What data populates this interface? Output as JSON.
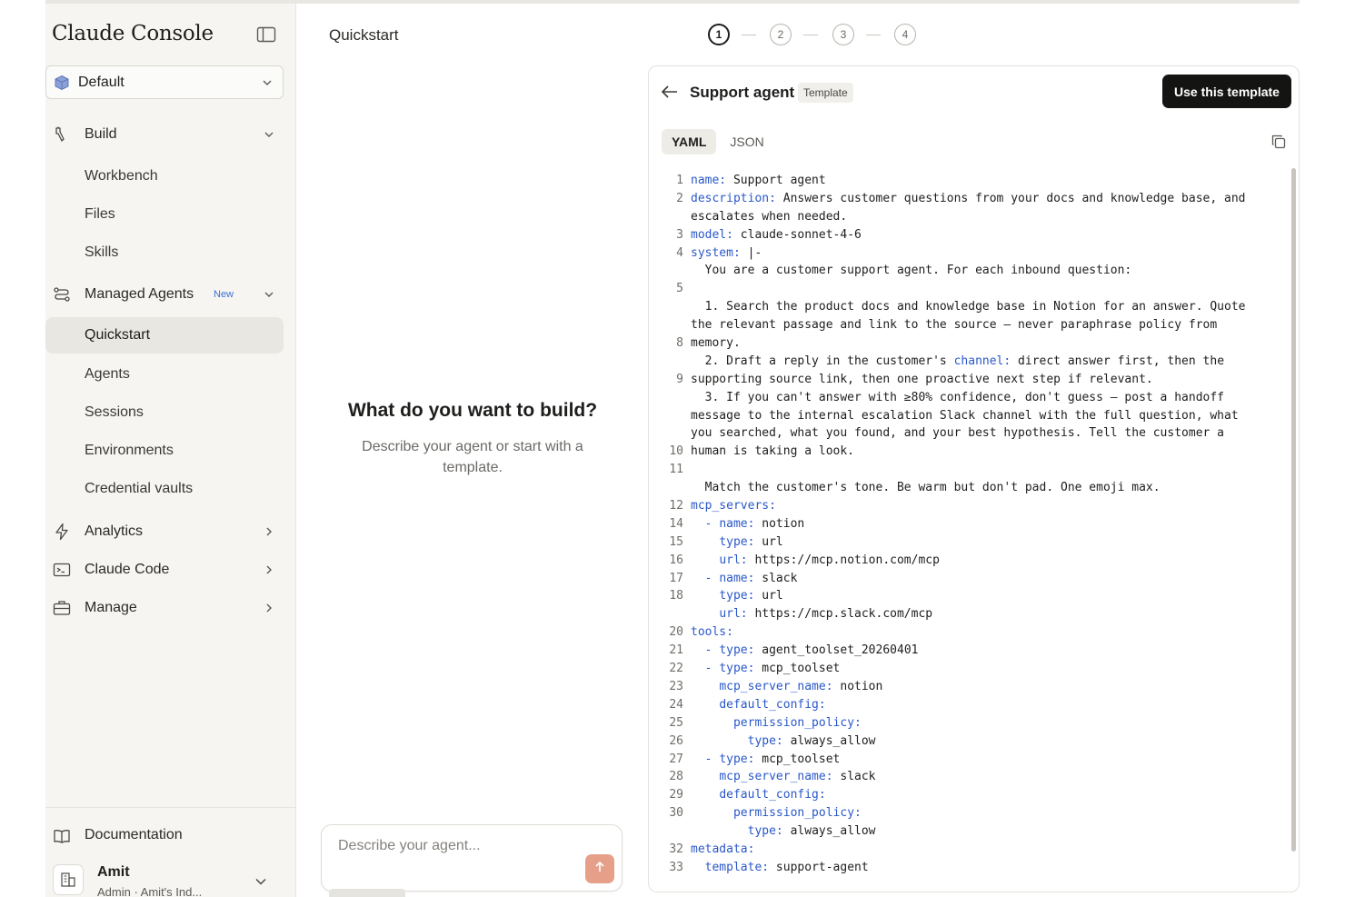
{
  "sidebar": {
    "brand": "Claude Console",
    "workspace": "Default",
    "build": {
      "label": "Build",
      "items": [
        "Workbench",
        "Files",
        "Skills"
      ]
    },
    "managed_agents": {
      "label": "Managed Agents",
      "badge": "New",
      "items": [
        "Quickstart",
        "Agents",
        "Sessions",
        "Environments",
        "Credential vaults"
      ]
    },
    "analytics": "Analytics",
    "claude_code": "Claude Code",
    "manage": "Manage",
    "documentation": "Documentation",
    "user": {
      "name": "Amit",
      "role": "Admin · Amit's Ind..."
    }
  },
  "main": {
    "page_title": "Quickstart",
    "steps": [
      "1",
      "2",
      "3",
      "4"
    ],
    "heading": "What do you want to build?",
    "subheading": "Describe your agent or start with a template.",
    "composer_placeholder": "Describe your agent..."
  },
  "panel": {
    "title": "Support agent",
    "badge": "Template",
    "use_button": "Use this template",
    "tabs": [
      "YAML",
      "JSON"
    ],
    "code_rows": [
      {
        "ln": "1",
        "parts": [
          [
            "k",
            "name:"
          ],
          [
            "",
            " Support agent"
          ]
        ]
      },
      {
        "ln": "2",
        "parts": [
          [
            "k",
            "description:"
          ],
          [
            "",
            " Answers customer questions from your docs and knowledge base, and"
          ]
        ]
      },
      {
        "ln": "",
        "parts": [
          [
            "",
            "escalates when needed."
          ]
        ]
      },
      {
        "ln": "3",
        "parts": [
          [
            "k",
            "model:"
          ],
          [
            "",
            " claude-sonnet-4-6"
          ]
        ]
      },
      {
        "ln": "4",
        "parts": [
          [
            "k",
            "system:"
          ],
          [
            "",
            " |-"
          ]
        ]
      },
      {
        "ln": "",
        "parts": [
          [
            "",
            "  You are a customer support agent. For each inbound question:"
          ]
        ]
      },
      {
        "ln": "5",
        "parts": []
      },
      {
        "ln": "",
        "parts": [
          [
            "",
            "  1. Search the product docs and knowledge base in Notion for an answer. Quote"
          ]
        ]
      },
      {
        "ln": "",
        "parts": [
          [
            "",
            "the relevant passage and link to the source — never paraphrase policy from"
          ]
        ]
      },
      {
        "ln": "8",
        "parts": [
          [
            "",
            "memory."
          ]
        ]
      },
      {
        "ln": "",
        "parts": [
          [
            "",
            "  2. Draft a reply in the customer's "
          ],
          [
            "k",
            "channel:"
          ],
          [
            "",
            " direct answer first, then the"
          ]
        ]
      },
      {
        "ln": "9",
        "parts": [
          [
            "",
            "supporting source link, then one proactive next step if relevant."
          ]
        ]
      },
      {
        "ln": "",
        "parts": [
          [
            "",
            "  3. If you can't answer with ≥80% confidence, don't guess — post a handoff"
          ]
        ]
      },
      {
        "ln": "",
        "parts": [
          [
            "",
            "message to the internal escalation Slack channel with the full question, what"
          ]
        ]
      },
      {
        "ln": "",
        "parts": [
          [
            "",
            "you searched, what you found, and your best hypothesis. Tell the customer a"
          ]
        ]
      },
      {
        "ln": "10",
        "parts": [
          [
            "",
            "human is taking a look."
          ]
        ]
      },
      {
        "ln": "11",
        "parts": []
      },
      {
        "ln": "",
        "parts": [
          [
            "",
            "  Match the customer's tone. Be warm but don't pad. One emoji max."
          ]
        ]
      },
      {
        "ln": "12",
        "parts": [
          [
            "k",
            "mcp_servers:"
          ]
        ]
      },
      {
        "ln": "14",
        "parts": [
          [
            "",
            "  "
          ],
          [
            "d",
            "-"
          ],
          [
            "",
            " "
          ],
          [
            "k",
            "name:"
          ],
          [
            "",
            " notion"
          ]
        ]
      },
      {
        "ln": "15",
        "parts": [
          [
            "",
            "    "
          ],
          [
            "k",
            "type:"
          ],
          [
            "",
            " url"
          ]
        ]
      },
      {
        "ln": "16",
        "parts": [
          [
            "",
            "    "
          ],
          [
            "k",
            "url:"
          ],
          [
            "",
            " https://mcp.notion.com/mcp"
          ]
        ]
      },
      {
        "ln": "17",
        "parts": [
          [
            "",
            "  "
          ],
          [
            "d",
            "-"
          ],
          [
            "",
            " "
          ],
          [
            "k",
            "name:"
          ],
          [
            "",
            " slack"
          ]
        ]
      },
      {
        "ln": "18",
        "parts": [
          [
            "",
            "    "
          ],
          [
            "k",
            "type:"
          ],
          [
            "",
            " url"
          ]
        ]
      },
      {
        "ln": "",
        "parts": [
          [
            "",
            "    "
          ],
          [
            "k",
            "url:"
          ],
          [
            "",
            " https://mcp.slack.com/mcp"
          ]
        ]
      },
      {
        "ln": "20",
        "parts": [
          [
            "k",
            "tools:"
          ]
        ]
      },
      {
        "ln": "21",
        "parts": [
          [
            "",
            "  "
          ],
          [
            "d",
            "-"
          ],
          [
            "",
            " "
          ],
          [
            "k",
            "type:"
          ],
          [
            "",
            " agent_toolset_20260401"
          ]
        ]
      },
      {
        "ln": "22",
        "parts": [
          [
            "",
            "  "
          ],
          [
            "d",
            "-"
          ],
          [
            "",
            " "
          ],
          [
            "k",
            "type:"
          ],
          [
            "",
            " mcp_toolset"
          ]
        ]
      },
      {
        "ln": "23",
        "parts": [
          [
            "",
            "    "
          ],
          [
            "k",
            "mcp_server_name:"
          ],
          [
            "",
            " notion"
          ]
        ]
      },
      {
        "ln": "24",
        "parts": [
          [
            "",
            "    "
          ],
          [
            "k",
            "default_config:"
          ]
        ]
      },
      {
        "ln": "25",
        "parts": [
          [
            "",
            "      "
          ],
          [
            "k",
            "permission_policy:"
          ]
        ]
      },
      {
        "ln": "26",
        "parts": [
          [
            "",
            "        "
          ],
          [
            "k",
            "type:"
          ],
          [
            "",
            " always_allow"
          ]
        ]
      },
      {
        "ln": "27",
        "parts": [
          [
            "",
            "  "
          ],
          [
            "d",
            "-"
          ],
          [
            "",
            " "
          ],
          [
            "k",
            "type:"
          ],
          [
            "",
            " mcp_toolset"
          ]
        ]
      },
      {
        "ln": "28",
        "parts": [
          [
            "",
            "    "
          ],
          [
            "k",
            "mcp_server_name:"
          ],
          [
            "",
            " slack"
          ]
        ]
      },
      {
        "ln": "29",
        "parts": [
          [
            "",
            "    "
          ],
          [
            "k",
            "default_config:"
          ]
        ]
      },
      {
        "ln": "30",
        "parts": [
          [
            "",
            "      "
          ],
          [
            "k",
            "permission_policy:"
          ]
        ]
      },
      {
        "ln": "",
        "parts": [
          [
            "",
            "        "
          ],
          [
            "k",
            "type:"
          ],
          [
            "",
            " always_allow"
          ]
        ]
      },
      {
        "ln": "32",
        "parts": [
          [
            "k",
            "metadata:"
          ]
        ]
      },
      {
        "ln": "33",
        "parts": [
          [
            "",
            "  "
          ],
          [
            "k",
            "template:"
          ],
          [
            "",
            " support-agent"
          ]
        ]
      }
    ]
  },
  "icons": {
    "sidebar_toggle": "panel-toggle-icon",
    "workspace": "cube-icon",
    "build": "wrench-icon",
    "managed_agents": "agents-flow-icon",
    "analytics": "bolt-icon",
    "claude_code": "terminal-icon",
    "manage": "briefcase-icon",
    "documentation": "book-icon",
    "org": "building-icon",
    "back": "arrow-left-icon",
    "copy": "copy-icon",
    "send": "arrow-up-icon"
  },
  "colors": {
    "accent_send": "#e6a08a",
    "primary_button": "#141413",
    "yaml_key": "#2a58c9",
    "new_badge": "#3b6fd6",
    "sidebar_bg": "#f6f5f2"
  }
}
